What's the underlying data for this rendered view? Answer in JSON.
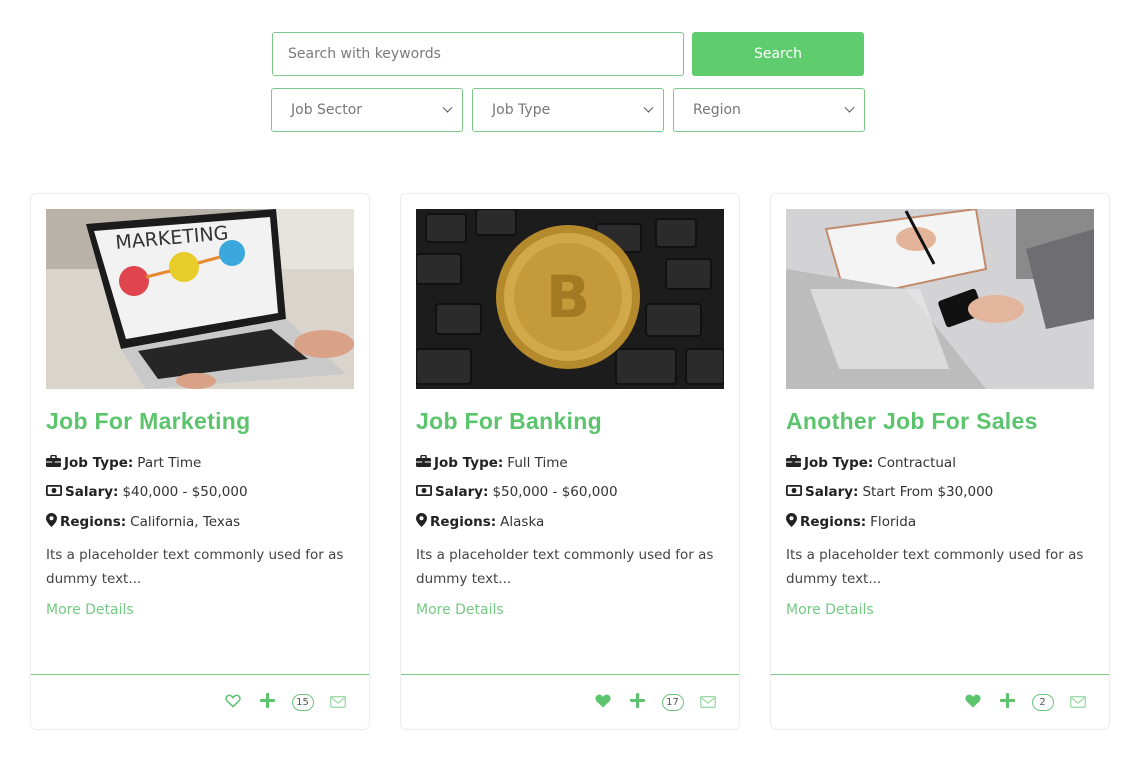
{
  "search": {
    "placeholder": "Search with keywords",
    "button_label": "Search"
  },
  "filters": [
    {
      "label": "Job Sector"
    },
    {
      "label": "Job Type"
    },
    {
      "label": "Region"
    }
  ],
  "colors": {
    "accent": "#5fcc6e",
    "title": "#5cc46d",
    "border": "#7cc98a"
  },
  "jobs": [
    {
      "title": "Job For Marketing",
      "image": "marketing-laptop-photo",
      "job_type_label": "Job Type:",
      "job_type": "Part Time",
      "salary_label": "Salary:",
      "salary": "$40,000 - $50,000",
      "regions_label": "Regions:",
      "regions": "California, Texas",
      "description": "Its a placeholder text commonly used for as dummy text...",
      "more_label": "More Details",
      "favorited": false,
      "count": "15"
    },
    {
      "title": "Job For Banking",
      "image": "bitcoin-keyboard-photo",
      "job_type_label": "Job Type:",
      "job_type": "Full Time",
      "salary_label": "Salary:",
      "salary": "$50,000 - $60,000",
      "regions_label": "Regions:",
      "regions": "Alaska",
      "description": "Its a placeholder text commonly used for as dummy text...",
      "more_label": "More Details",
      "favorited": true,
      "count": "17"
    },
    {
      "title": "Another Job For Sales",
      "image": "desk-writing-phone-photo",
      "job_type_label": "Job Type:",
      "job_type": "Contractual",
      "salary_label": "Salary:",
      "salary": "Start From $30,000",
      "regions_label": "Regions:",
      "regions": "Florida",
      "description": "Its a placeholder text commonly used for as dummy text...",
      "more_label": "More Details",
      "favorited": true,
      "count": "2"
    }
  ]
}
